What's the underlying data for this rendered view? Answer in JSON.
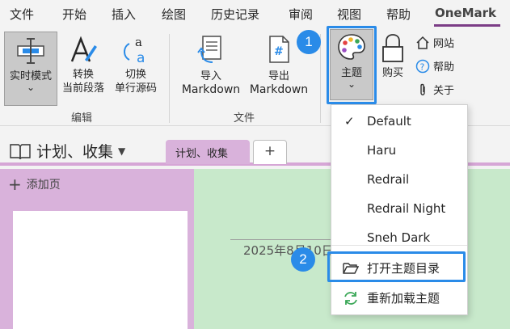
{
  "menu": {
    "items": [
      "文件",
      "开始",
      "插入",
      "绘图",
      "历史记录",
      "审阅",
      "视图",
      "帮助",
      "OneMark"
    ],
    "active": "OneMark"
  },
  "ribbon": {
    "edit": {
      "realtime_mode": "实时模式",
      "realtime_chevron": "⌄",
      "convert_line1": "转换",
      "convert_line2": "当前段落",
      "switch_line1": "切换",
      "switch_line2": "单行源码",
      "group_label": "编辑"
    },
    "file": {
      "import_line1": "导入",
      "import_line2": "Markdown",
      "export_line1": "导出",
      "export_line2": "Markdown",
      "group_label": "文件"
    },
    "theme_label": "主题",
    "theme_chevron": "⌄",
    "buy_label": "购买",
    "website_label": "网站",
    "help_label": "帮助",
    "about_label": "关于"
  },
  "notebook": {
    "title": "计划、收集",
    "tab_label": "计划、收集",
    "add_tab": "+"
  },
  "pages": {
    "add_page_label": "添加页"
  },
  "canvas": {
    "date_text": "2025年8月10日"
  },
  "dropdown": {
    "items": [
      "Default",
      "Haru",
      "Redrail",
      "Redrail Night",
      "Sneh Dark"
    ],
    "checked": "Default",
    "open_theme_dir": "打开主题目录",
    "reload_theme": "重新加载主题"
  },
  "annotations": {
    "step1": "1",
    "step2": "2",
    "color": "#2a8be8"
  },
  "colors": {
    "accent": "#7b3d86",
    "pages_pane": "#d9b2db",
    "canvas": "#c8e9cb"
  }
}
